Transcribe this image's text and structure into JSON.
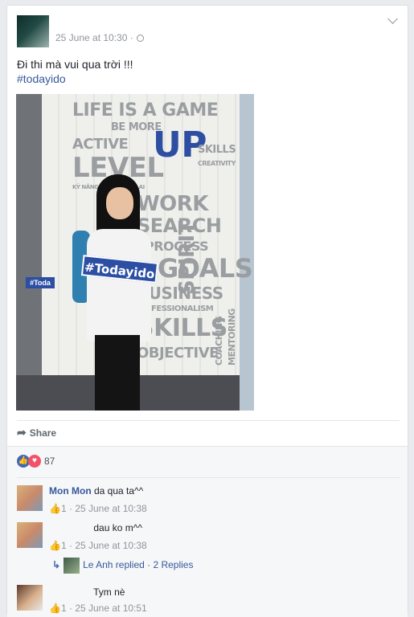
{
  "post": {
    "timestamp": "25 June at 10:30 ·",
    "text": "Đi thi mà vui qua trời !!!",
    "hashtag": "#todayido"
  },
  "photo": {
    "wall_lines": [
      "LIFE IS A GAME",
      "BE MORE",
      "ACTIVE",
      "LEVEL",
      "UP",
      "SKILLS",
      "CREATIVITY",
      "WORK",
      "SEARCH",
      "PROCESS",
      "GOALS",
      "BUSINESS",
      "PROFESSIONALISM",
      "SKILLS",
      "OBJECTIVE",
      "SPIRIT",
      "COACHING",
      "MENTORING",
      "KỸ NĂNG CỦA TƯƠNG LAI"
    ],
    "sign_text": "#Todayido",
    "left_sign": "#Toda"
  },
  "actions": {
    "share_label": "Share"
  },
  "reactions": {
    "count": "87"
  },
  "comments": [
    {
      "name": "Mon Mon",
      "text": "da qua ta^^",
      "likes": "1",
      "time": "· 25 June at 10:38"
    },
    {
      "name": "",
      "text": "dau ko m^^",
      "likes": "1",
      "time": "· 25 June at 10:38"
    },
    {
      "name": "",
      "text": "Tym nè",
      "likes": "1",
      "time": "· 25 June at 10:51"
    }
  ],
  "reply": {
    "text": "Le Anh replied · 2 Replies"
  },
  "colors": {
    "link": "#365899",
    "accent": "#4267b2",
    "love": "#f25268"
  }
}
